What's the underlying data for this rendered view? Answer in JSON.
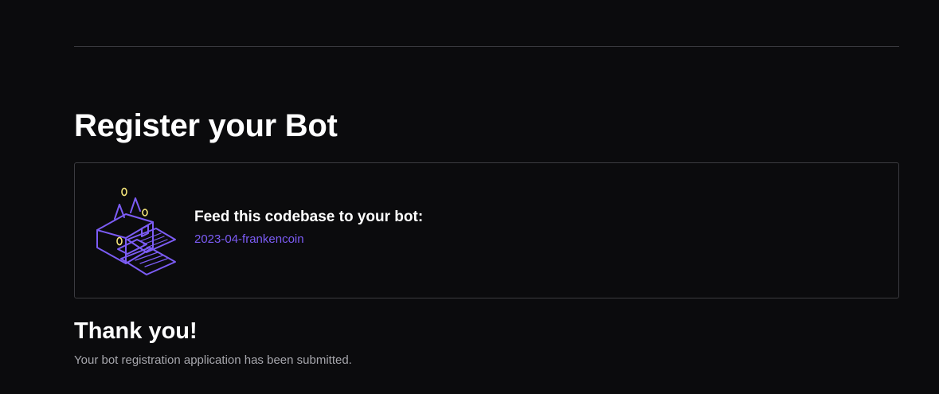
{
  "page": {
    "title": "Register your Bot"
  },
  "card": {
    "heading": "Feed this codebase to your bot:",
    "codebase_link": "2023-04-frankencoin",
    "illustration_icon": "bot-printer-icon"
  },
  "confirmation": {
    "heading": "Thank you!",
    "message": "Your bot registration application has been submitted."
  },
  "colors": {
    "background": "#0b0b0d",
    "accent": "#7c5cf5",
    "illustration_highlight": "#f5e67a",
    "muted_text": "#a7a7ad",
    "border": "#3b3b40"
  }
}
